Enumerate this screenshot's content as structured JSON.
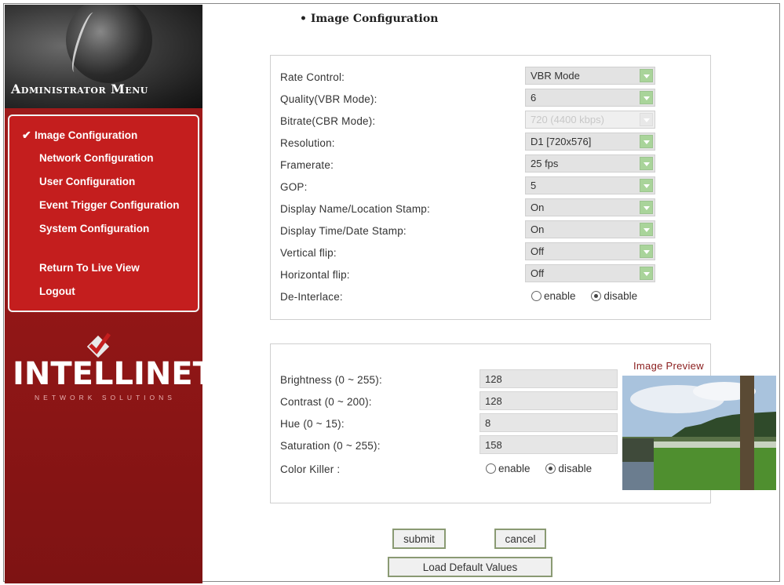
{
  "sidebar": {
    "title": "Administrator Menu",
    "menu": [
      {
        "label": "Image Configuration",
        "active": true
      },
      {
        "label": "Network Configuration"
      },
      {
        "label": "User Configuration"
      },
      {
        "label": "Event Trigger Configuration"
      },
      {
        "label": "System Configuration"
      },
      {
        "label": "Return To Live View"
      },
      {
        "label": "Logout"
      }
    ],
    "logo": {
      "text": "INTELLINET",
      "sub": "NETWORK SOLUTIONS"
    }
  },
  "page": {
    "title": "• Image Configuration"
  },
  "settings": [
    {
      "label": "Rate Control:",
      "value": "VBR Mode"
    },
    {
      "label": "Quality(VBR Mode):",
      "value": "6"
    },
    {
      "label": "Bitrate(CBR Mode):",
      "value": "720 (4400 kbps)",
      "disabled": true
    },
    {
      "label": "Resolution:",
      "value": "D1 [720x576]"
    },
    {
      "label": "Framerate:",
      "value": "25 fps"
    },
    {
      "label": "GOP:",
      "value": "5"
    },
    {
      "label": "Display Name/Location Stamp:",
      "value": "On"
    },
    {
      "label": "Display Time/Date Stamp:",
      "value": "On"
    },
    {
      "label": "Vertical flip:",
      "value": "Off"
    },
    {
      "label": "Horizontal flip:",
      "value": "Off"
    }
  ],
  "deinterlace": {
    "label": "De-Interlace:",
    "options": [
      "enable",
      "disable"
    ],
    "selected": "disable"
  },
  "image": [
    {
      "label": "Brightness (0 ~ 255):",
      "value": "128"
    },
    {
      "label": "Contrast (0 ~ 200):",
      "value": "128"
    },
    {
      "label": "Hue (0 ~ 15):",
      "value": "8"
    },
    {
      "label": "Saturation (0 ~ 255):",
      "value": "158"
    }
  ],
  "color_killer": {
    "label": "Color Killer :",
    "options": [
      "enable",
      "disable"
    ],
    "selected": "disable"
  },
  "preview": {
    "label": "Image Preview"
  },
  "buttons": {
    "submit": "submit",
    "cancel": "cancel",
    "load_default": "Load Default Values"
  },
  "colors": {
    "sidebar_red": "#a51c1c",
    "menu_red": "#c41e1e",
    "arrow_green": "#a9d49a"
  }
}
